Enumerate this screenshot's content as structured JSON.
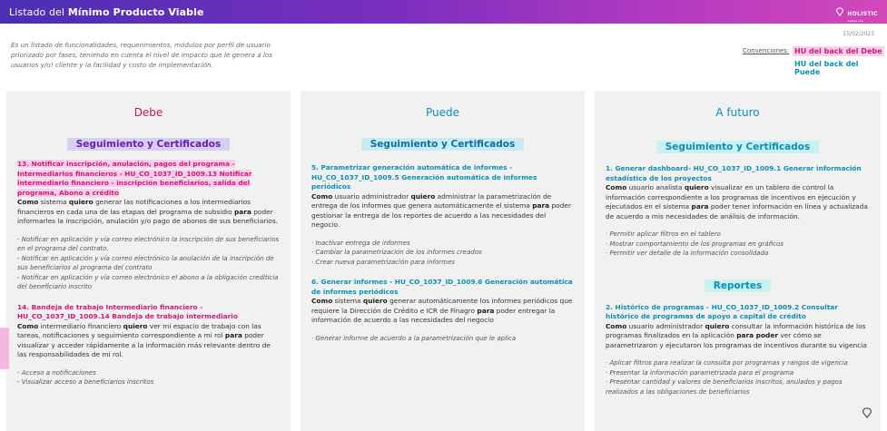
{
  "header": {
    "title_prefix": "Listado del ",
    "title_bold": "Mínimo Producto Viable",
    "brand": "HOLISTIC",
    "brand_sub": "design lab"
  },
  "intro": "Es un listado de funcionalidades, requerimientos, módulos por perfil de usuario priorizado por fases, teniendo en cuenta el nivel de impacto que le genera a los usuarios y/o! cliente y la facilidad y costo de implementación.",
  "date": "15/02/2023",
  "conventions": {
    "label": "Convenciones:",
    "debe": "HU del back del Debe",
    "puede": "HU del back del Puede"
  },
  "colors": {
    "debe_accent": "#d6157a",
    "puede_accent": "#0a8fb8",
    "header_gradient_start": "#4a2fb5",
    "header_gradient_end": "#d248b9"
  },
  "columns": {
    "debe": {
      "title": "Debe",
      "section": "Seguimiento y  Certificados",
      "stories": [
        {
          "title": "13. Notificar inscripción, anulación, pagos del programa - Intermediarios financieros - HU_CO_1037_ID_1009.13 Notificar intermediario financiero - inscripción beneficiarios, salida del programa, Abono a crédito",
          "d_pre": "Como",
          "d1": " sistema ",
          "d_quiero": "quiero",
          "d2": " generar las notificaciones a los intermediarios financieros en cada una de las etapas del programa de subsidio ",
          "d_para": "para",
          "d3": " poder informarles la inscripción, anulación y/o pago de abonos de sus beneficiarios.",
          "bullets": [
            "- Notificar en aplicación y vía correo electrónico la inscripción de sus beneficiarios en el programa del contrato.",
            "- Notificar en aplicación y vía correo electrónico la anulación de la inscripción de sus beneficiarios al programa del contrato",
            "- Notificar en aplicación y vía correo electrónico el abono a la obligación crediticia del beneficiario inscrito"
          ]
        },
        {
          "title": "14. Bandeja de trabajo Intermediario financiero - HU_CO_1037_ID_1009.14 Bandeja de trabajo intermediario",
          "d_pre": "Como",
          "d1": " intermediario financiero ",
          "d_quiero": "quiero",
          "d2": " ver mi espacio de trabajo con las tareas, notificaciones y seguimiento correspondiente a mi rol ",
          "d_para": "para",
          "d3": " poder visualizar y acceder rápidamente a la información más relevante dentro de las responsabilidades de mi rol.",
          "bullets": [
            "- Acceso a notificaciones",
            "- Visualizar acceso a beneficiarios inscritos"
          ]
        }
      ]
    },
    "puede": {
      "title": "Puede",
      "section": "Seguimiento y Certificados",
      "stories": [
        {
          "title": "5. Parametrizar generación automática de informes - HU_CO_1037_ID_1009.5 Generación automática de informes periódicos",
          "d_pre": "Como",
          "d1": " usuario administrador ",
          "d_quiero": "quiero",
          "d2": " administrar la parametrización de entrega de los informes que genera automáticamente el sistema ",
          "d_para": "para",
          "d3": " poder gestionar la entrega de los reportes de acuerdo a las necesidades del negocio.",
          "bullets": [
            "· Inactivar entrega de informes",
            "· Cambiar la parametrización de los informes creados",
            "· Crear nueva parametrización para informes"
          ]
        },
        {
          "title": "6. Generar informes - HU_CO_1037_ID_1009.6 Generación automática de informes periódicos",
          "d_pre": "Como",
          "d1": " sistema ",
          "d_quiero": "quiero",
          "d2": " generar automáticamente los informes periódicos que requiere la Dirección de Crédito e ICR de Finagro ",
          "d_para": "para",
          "d3": " poder entregar la información de acuerdo a las necesidades del negocio",
          "bullets": [
            "· Generar informe de acuerdo a la parametrización que le aplica"
          ]
        }
      ]
    },
    "futuro": {
      "title": "A futuro",
      "section": "Seguimiento y Certificados",
      "section2": "Reportes",
      "stories": [
        {
          "title": "1. Generar dashboard- HU_CO_1037_ID_1009.1 Generar información estadística de los proyectos",
          "d_pre": "Como",
          "d1": " usuario analista ",
          "d_quiero": "quiero",
          "d2": " visualizar en un tablero de control la información correspondiente a los programas de incentivos en ejecución y ejecutados en el sistema ",
          "d_para": "para",
          "d3": " poder tener información en línea y actualizada de acuerdo a mis necesidades de análisis de información.",
          "bullets": [
            "· Permitir aplicar filtros en el tablero",
            "· Mostrar comportamiento de los programas en gráficos",
            "· Permitir ver detalle de la información consolidada"
          ]
        },
        {
          "title": "2. Histórico de programas -  HU_CO_1037_ID_1009.2 Consultar histórico de programas de apoyo a capital de crédito",
          "d_pre": "Como",
          "d1": " usuario administrador ",
          "d_quiero": "quiero",
          "d2": " consultar la información histórica de los programas finalizados en la aplicación ",
          "d_para": "para poder",
          "d3": " ver cómo se parametrizaron y ejecutaron los programas de incentivos durante su vigencia",
          "bullets": [
            "· Aplicar filtros para realizar la consulta por programas y rangos de vigencia",
            "· Presentar la información parametrizada para el programa",
            "· Presentar cantidad y valores de beneficiarios inscritos, anulados y pagos realizados a las obligaciones de beneficiarios"
          ]
        }
      ]
    }
  }
}
